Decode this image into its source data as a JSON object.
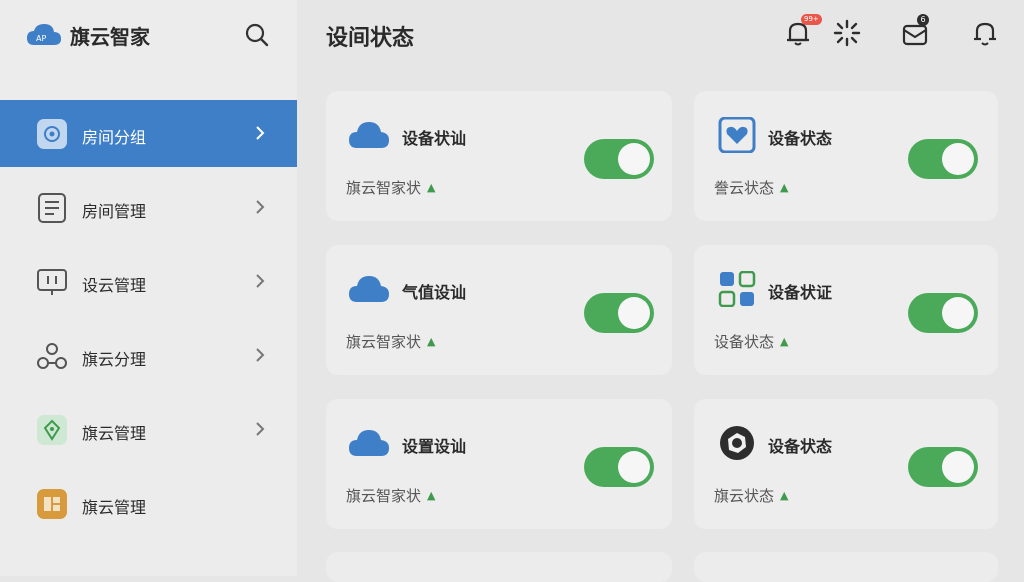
{
  "app": {
    "name": "旗云智家"
  },
  "sidebar": {
    "items": [
      {
        "label": "房间分组",
        "icon": "room-group-icon",
        "active": true
      },
      {
        "label": "房间管理",
        "icon": "document-list-icon",
        "active": false
      },
      {
        "label": "设云管理",
        "icon": "monitor-icon",
        "active": false
      },
      {
        "label": "旗云分理",
        "icon": "nodes-icon",
        "active": false
      },
      {
        "label": "旗云管理",
        "icon": "leaf-badge-icon",
        "active": false
      },
      {
        "label": "旗云管理",
        "icon": "orange-app-icon",
        "active": false
      }
    ]
  },
  "header": {
    "title": "设间状态",
    "notification_badge": "99+",
    "mail_badge": "6"
  },
  "cards": [
    {
      "title": "设备状讪",
      "subtitle": "旗云智家状",
      "icon": "cloud-icon",
      "enabled": true
    },
    {
      "title": "设备状态",
      "subtitle": "誊云状态",
      "icon": "heart-shield-icon",
      "enabled": true
    },
    {
      "title": "气值设讪",
      "subtitle": "旗云智家状",
      "icon": "cloud-icon",
      "enabled": true
    },
    {
      "title": "设备状证",
      "subtitle": "设备状态",
      "icon": "grid-apps-icon",
      "enabled": true
    },
    {
      "title": "设置设讪",
      "subtitle": "旗云智家状",
      "icon": "cloud-icon",
      "enabled": true
    },
    {
      "title": "设备状态",
      "subtitle": "旗云状态",
      "icon": "octagon-lens-icon",
      "enabled": true
    }
  ],
  "colors": {
    "accent": "#3f7fc8",
    "toggle_on": "#4aaa5a",
    "badge": "#e8574a",
    "trend_up": "#3f9a4e"
  }
}
